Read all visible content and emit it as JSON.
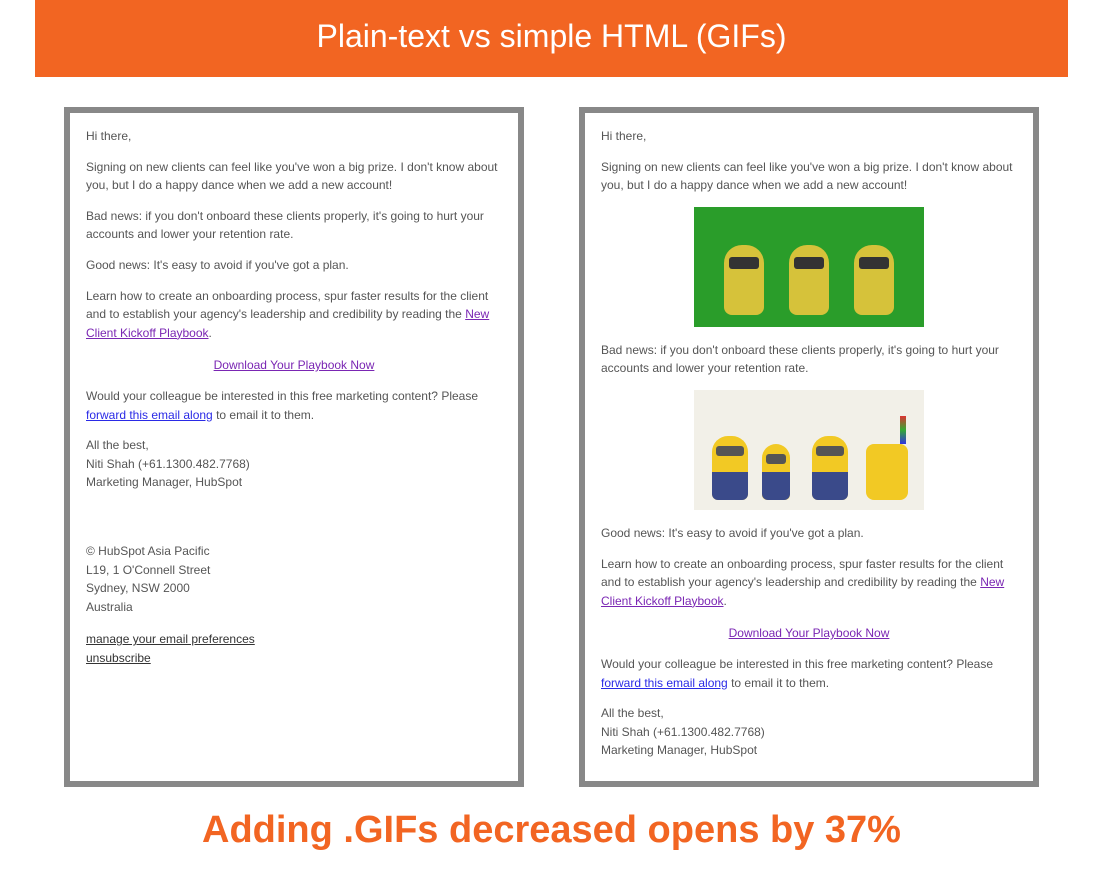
{
  "banner": "Plain-text vs simple HTML (GIFs)",
  "email": {
    "greeting": "Hi there,",
    "p1": "Signing on new clients can feel like you've won a big prize. I don't know about you, but I do a happy dance when we add a new account!",
    "p2": "Bad news: if you don't onboard these clients properly, it's going to hurt your accounts and lower your retention rate.",
    "p3": "Good news: It's easy to avoid if you've got a plan.",
    "p4_pre": "Learn how to create an onboarding process, spur faster results for the client and to establish your agency's leadership and credibility by reading the ",
    "p4_link": "New Client Kickoff Playbook",
    "p4_post": ".",
    "download": "Download Your Playbook Now",
    "p5_pre": "Would your colleague be interested in this free marketing content? Please ",
    "p5_link": "forward this email along",
    "p5_post": " to email it to them.",
    "sig1": "All the best,",
    "sig2": "Niti Shah (+61.1300.482.7768)",
    "sig3": "Marketing Manager, HubSpot",
    "foot1": "© HubSpot Asia Pacific",
    "foot2": "L19, 1 O'Connell Street",
    "foot3": "Sydney, NSW 2000",
    "foot4": "Australia",
    "manage": "manage your email preferences",
    "unsub": "unsubscribe"
  },
  "caption": "Adding .GIFs decreased opens by 37%"
}
